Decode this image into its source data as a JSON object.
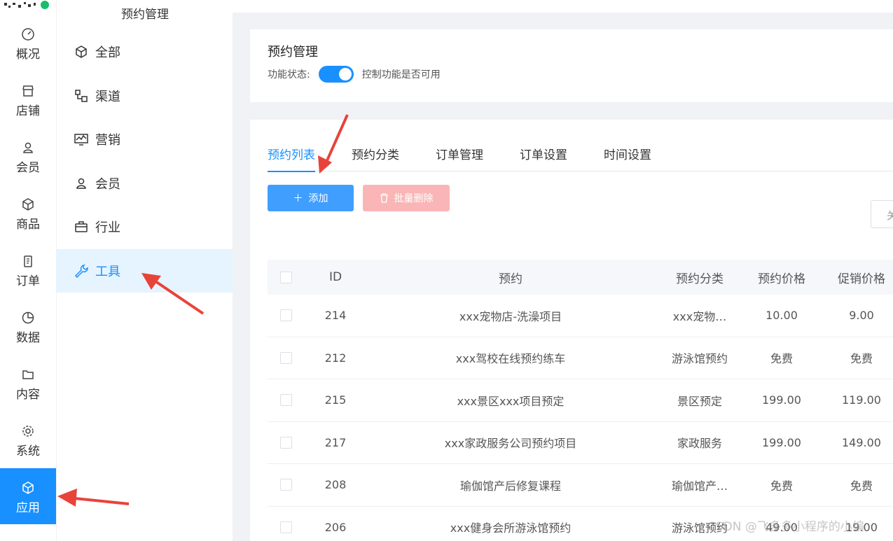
{
  "primary_nav": [
    {
      "label": "概况",
      "icon": "dashboard-icon"
    },
    {
      "label": "店铺",
      "icon": "store-icon"
    },
    {
      "label": "会员",
      "icon": "user-icon"
    },
    {
      "label": "商品",
      "icon": "box-icon"
    },
    {
      "label": "订单",
      "icon": "clipboard-icon"
    },
    {
      "label": "数据",
      "icon": "pie-chart-icon"
    },
    {
      "label": "内容",
      "icon": "folder-icon"
    },
    {
      "label": "系统",
      "icon": "gear-icon"
    },
    {
      "label": "应用",
      "icon": "box-icon",
      "active": true
    }
  ],
  "secondary_nav": {
    "title": "预约管理",
    "items": [
      {
        "label": "全部",
        "icon": "cube-icon"
      },
      {
        "label": "渠道",
        "icon": "channel-icon"
      },
      {
        "label": "营销",
        "icon": "monitor-chart-icon"
      },
      {
        "label": "会员",
        "icon": "user-icon"
      },
      {
        "label": "行业",
        "icon": "briefcase-icon"
      },
      {
        "label": "工具",
        "icon": "wrench-icon",
        "active": true
      }
    ]
  },
  "settings": {
    "title": "预约管理",
    "status_label": "功能状态:",
    "status_on": true,
    "status_hint": "控制功能是否可用"
  },
  "tabs": [
    {
      "label": "预约列表",
      "active": true
    },
    {
      "label": "预约分类"
    },
    {
      "label": "订单管理"
    },
    {
      "label": "订单设置"
    },
    {
      "label": "时间设置"
    }
  ],
  "toolbar": {
    "add_label": "添加",
    "batch_delete_label": "批量删除",
    "search_partial": "关"
  },
  "table": {
    "headers": {
      "id": "ID",
      "name": "预约",
      "category": "预约分类",
      "price": "预约价格",
      "promo": "促销价格"
    },
    "rows": [
      {
        "id": "214",
        "name": "xxx宠物店-洗澡项目",
        "category": "xxx宠物…",
        "price": "10.00",
        "promo": "9.00"
      },
      {
        "id": "212",
        "name": "xxx驾校在线预约练车",
        "category": "游泳馆预约",
        "price": "免费",
        "promo": "免费"
      },
      {
        "id": "215",
        "name": "xxx景区xxx项目预定",
        "category": "景区预定",
        "price": "199.00",
        "promo": "119.00"
      },
      {
        "id": "217",
        "name": "xxx家政服务公司预约项目",
        "category": "家政服务",
        "price": "199.00",
        "promo": "149.00"
      },
      {
        "id": "208",
        "name": "瑜伽馆产后修复课程",
        "category": "瑜伽馆产…",
        "price": "免费",
        "promo": "免费"
      },
      {
        "id": "206",
        "name": "xxx健身会所游泳馆预约",
        "category": "游泳馆预约",
        "price": "49.00",
        "promo": "19.00"
      }
    ]
  },
  "watermark": "CSDN @飞多多小程序的小编",
  "colors": {
    "accent": "#1890ff",
    "button": "#409eff",
    "danger_disabled": "#fab6b6",
    "annotation": "#e8433a"
  }
}
